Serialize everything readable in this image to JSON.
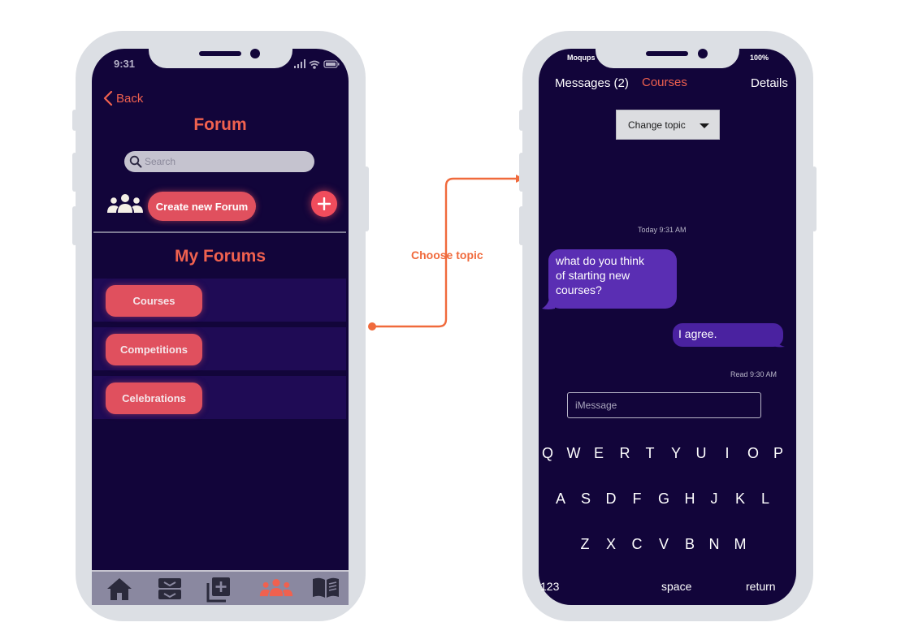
{
  "phone1": {
    "status_time": "9:31",
    "back_label": "Back",
    "title": "Forum",
    "search_placeholder": "Search",
    "create_button_label": "Create new Forum",
    "my_forums_title": "My Forums",
    "forums": [
      {
        "label": "Courses"
      },
      {
        "label": "Competitions"
      },
      {
        "label": "Celebrations"
      }
    ],
    "tabbar": [
      "home-icon",
      "inbox-icon",
      "add-library-icon",
      "group-icon",
      "book-icon"
    ],
    "active_tab": "group-icon",
    "accent_color": "#f0614f"
  },
  "connector": {
    "label": "Choose topic",
    "color": "#f06a3c"
  },
  "phone2": {
    "status_carrier": "Moqups",
    "status_battery": "100%",
    "nav_messages": "Messages (2)",
    "nav_current": "Courses",
    "nav_details": "Details",
    "change_topic_label": "Change topic",
    "timestamp": "Today 9:31 AM",
    "messages": [
      {
        "lines": [
          "what do you think",
          "of starting new",
          "courses?"
        ],
        "direction": "incoming"
      },
      {
        "lines": [
          "I agree."
        ],
        "direction": "outgoing"
      }
    ],
    "read_receipt": "Read 9:30 AM",
    "input_placeholder": "iMessage",
    "keyboard": {
      "row1": [
        "Q",
        "W",
        "E",
        "R",
        "T",
        "Y",
        "U",
        "I",
        "O",
        "P"
      ],
      "row2": [
        "A",
        "S",
        "D",
        "F",
        "G",
        "H",
        "J",
        "K",
        "L"
      ],
      "row3": [
        "Z",
        "X",
        "C",
        "V",
        "B",
        "N",
        "M"
      ],
      "numbers_key": "123",
      "space_key": "space",
      "return_key": "return"
    }
  }
}
